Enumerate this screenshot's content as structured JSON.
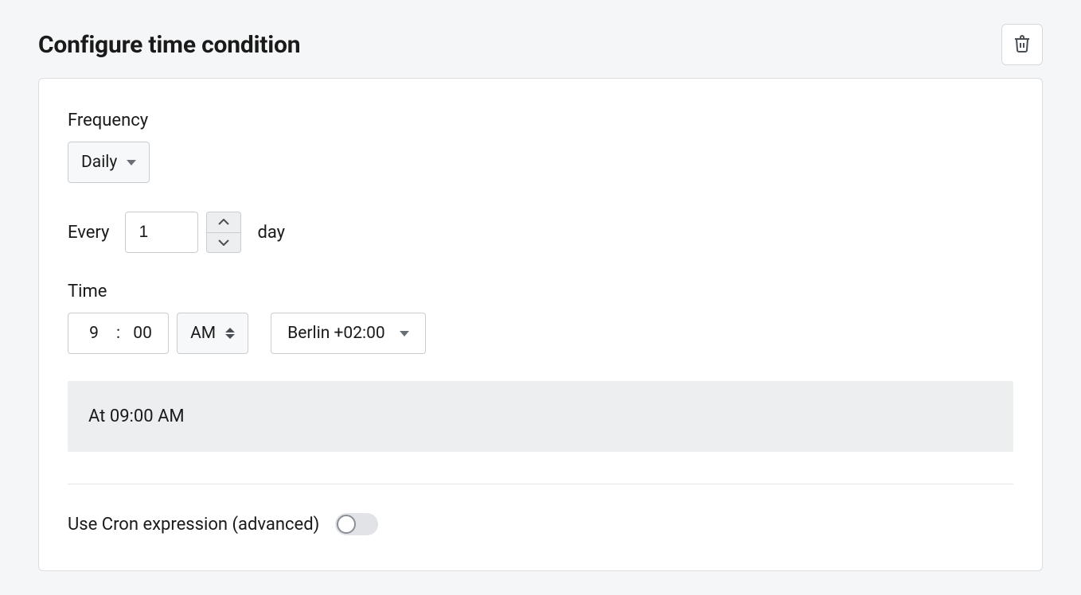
{
  "header": {
    "title": "Configure time condition"
  },
  "frequency": {
    "label": "Frequency",
    "value": "Daily"
  },
  "interval": {
    "prefix": "Every",
    "value": "1",
    "unit": "day"
  },
  "time": {
    "label": "Time",
    "hour": "9",
    "minute": "00",
    "ampm": "AM",
    "timezone": "Berlin +02:00"
  },
  "summary": {
    "text": "At 09:00 AM"
  },
  "cron": {
    "label": "Use Cron expression (advanced)",
    "enabled": false
  }
}
